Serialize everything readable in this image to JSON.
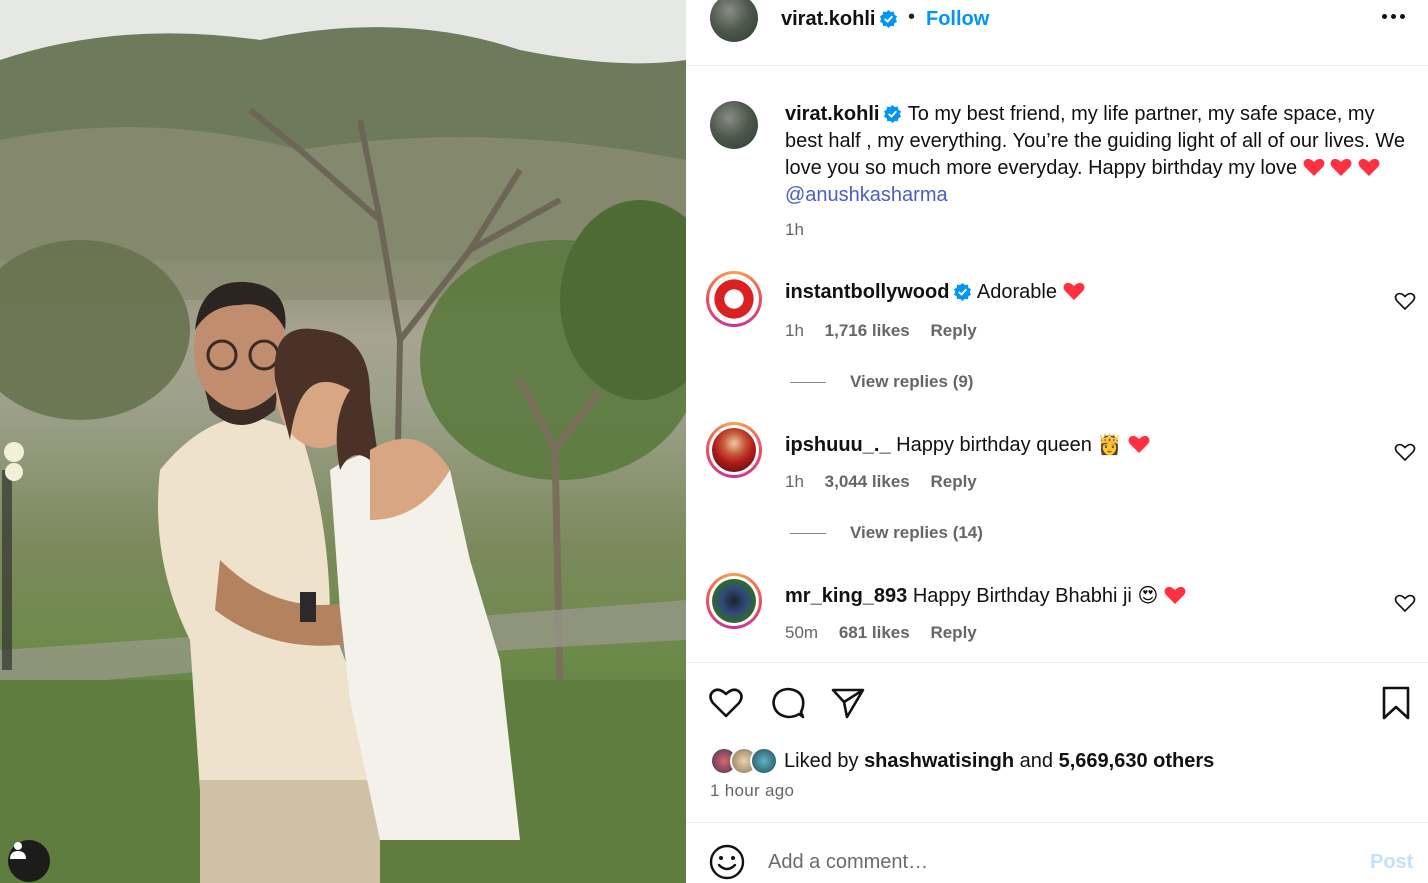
{
  "post": {
    "author": "virat.kohli",
    "follow_label": "Follow",
    "separator": "•",
    "caption_text": "To my best friend, my life partner, my safe space, my best half , my everything. You’re the guiding light of all of our lives. We love you so much more everyday. Happy birthday my love",
    "caption_mention": "@anushkasharma",
    "caption_time": "1h",
    "liked_by_prefix": "Liked by",
    "liked_by_user": "shashwatisingh",
    "liked_by_and": "and",
    "liked_by_others": "5,669,630 others",
    "posted_ago": "1 hour ago"
  },
  "comments": [
    {
      "user": "instantbollywood",
      "text": "Adorable",
      "time": "1h",
      "likes": "1,716 likes",
      "reply": "Reply",
      "view_replies": "View replies (9)"
    },
    {
      "user": "ipshuuu_._",
      "text": "Happy birthday queen",
      "emoji": "👸",
      "time": "1h",
      "likes": "3,044 likes",
      "reply": "Reply",
      "view_replies": "View replies (14)"
    },
    {
      "user": "mr_king_893",
      "text": "Happy Birthday Bhabhi ji",
      "emoji": "😍",
      "time": "50m",
      "likes": "681 likes",
      "reply": "Reply"
    }
  ],
  "comment_box": {
    "placeholder": "Add a comment…",
    "post_label": "Post"
  },
  "colors": {
    "link": "#0095f6",
    "mention": "#4a5ec2",
    "heart": "#ff3040",
    "verified": "#0095f6"
  },
  "icons": [
    "more-options-icon",
    "verified-badge-icon",
    "heart-icon",
    "comment-icon",
    "share-icon",
    "bookmark-icon",
    "emoji-icon",
    "profile-icon"
  ]
}
